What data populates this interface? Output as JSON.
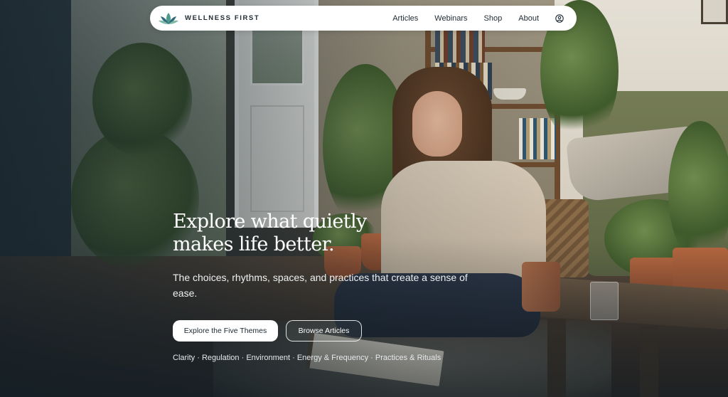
{
  "brand": {
    "name": "WELLNESS FIRST",
    "logo_icon": "lotus-icon",
    "logo_colors": [
      "#2f6b78",
      "#4f9a8f",
      "#7fb9a9"
    ]
  },
  "nav": {
    "links": [
      "Articles",
      "Webinars",
      "Shop",
      "About"
    ],
    "account_icon": "user-circle-icon"
  },
  "hero": {
    "headline_line1": "Explore what quietly",
    "headline_line2": "makes life better.",
    "subheading": "The choices, rhythms, spaces, and practices that create a sense of ease.",
    "primary_cta": "Explore the Five Themes",
    "secondary_cta": "Browse Articles",
    "themes": "Clarity · Regulation · Environment · Energy & Frequency · Practices & Rituals"
  }
}
